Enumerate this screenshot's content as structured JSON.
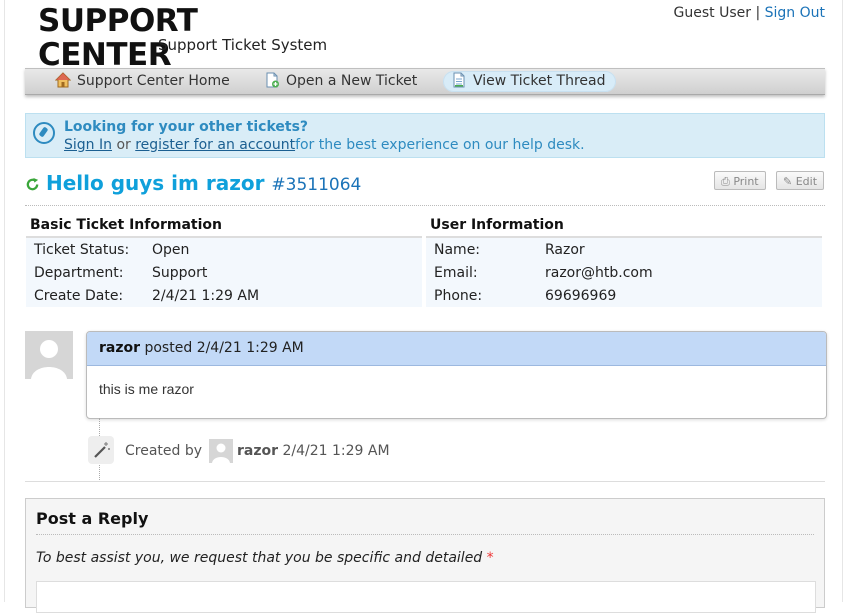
{
  "header": {
    "logo_title": "SUPPORT CENTER",
    "logo_subtitle": "Support Ticket System",
    "user_label": "Guest User",
    "separator": "|",
    "sign_out": "Sign Out"
  },
  "nav": {
    "items": [
      {
        "label": "Support Center Home",
        "icon": "home-icon",
        "active": false
      },
      {
        "label": "Open a New Ticket",
        "icon": "new-ticket-icon",
        "active": false
      },
      {
        "label": "View Ticket Thread",
        "icon": "ticket-thread-icon",
        "active": true
      }
    ]
  },
  "notice": {
    "heading": "Looking for your other tickets?",
    "sign_in": "Sign In",
    "or": "or",
    "register": "register for an account",
    "tail": "for the best experience on our help desk."
  },
  "ticket": {
    "subject": "Hello guys im razor",
    "number": "#3511064",
    "print_label": "Print",
    "edit_label": "Edit"
  },
  "basic_info": {
    "heading": "Basic Ticket Information",
    "rows": [
      {
        "key": "Ticket Status:",
        "value": "Open"
      },
      {
        "key": "Department:",
        "value": "Support"
      },
      {
        "key": "Create Date:",
        "value": "2/4/21 1:29 AM"
      }
    ]
  },
  "user_info": {
    "heading": "User Information",
    "rows": [
      {
        "key": "Name:",
        "value": "Razor"
      },
      {
        "key": "Email:",
        "value": "razor@htb.com"
      },
      {
        "key": "Phone:",
        "value": "69696969"
      }
    ]
  },
  "thread": {
    "author": "razor",
    "posted_label": "posted",
    "date": "2/4/21 1:29 AM",
    "message": "this is me razor"
  },
  "event": {
    "created_by": "Created by",
    "author": "razor",
    "date": "2/4/21 1:29 AM"
  },
  "reply": {
    "heading": "Post a Reply",
    "hint": "To best assist you, we request that you be specific and detailed",
    "required_mark": "*"
  },
  "colors": {
    "accent": "#0fa0db",
    "link": "#1b73b8",
    "notice_bg": "#d9edf7",
    "thread_header": "#c2d9f7"
  }
}
